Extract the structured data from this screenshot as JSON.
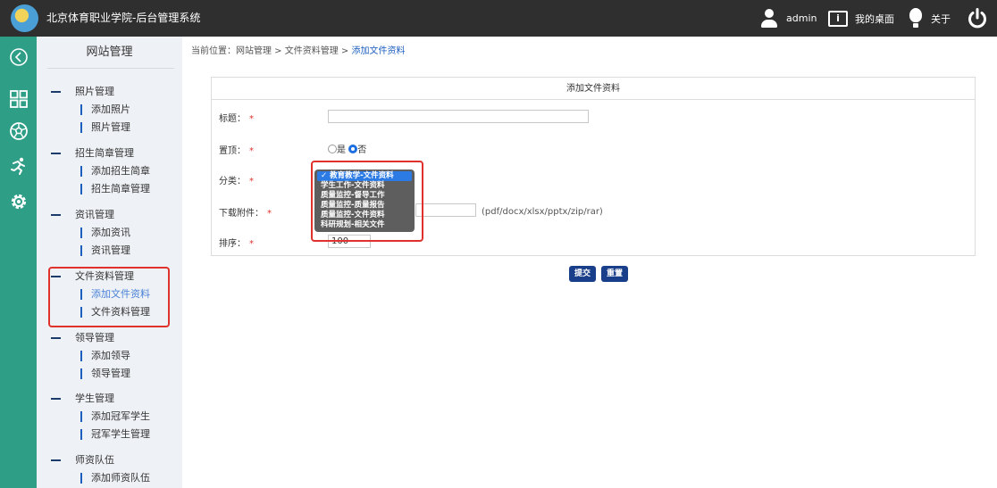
{
  "header": {
    "title": "北京体育职业学院-后台管理系统",
    "user": "admin",
    "desk_icon_glyph": "i",
    "desk": "我的桌面",
    "about": "关于"
  },
  "sidebar": {
    "title": "网站管理",
    "groups": [
      {
        "label": "照片管理",
        "items": [
          "添加照片",
          "照片管理"
        ]
      },
      {
        "label": "招生简章管理",
        "items": [
          "添加招生简章",
          "招生简章管理"
        ]
      },
      {
        "label": "资讯管理",
        "items": [
          "添加资讯",
          "资讯管理"
        ]
      },
      {
        "label": "文件资料管理",
        "items": [
          "添加文件资料",
          "文件资料管理"
        ]
      },
      {
        "label": "领导管理",
        "items": [
          "添加领导",
          "领导管理"
        ]
      },
      {
        "label": "学生管理",
        "items": [
          "添加冠军学生",
          "冠军学生管理"
        ]
      },
      {
        "label": "师资队伍",
        "items": [
          "添加师资队伍"
        ]
      }
    ]
  },
  "breadcrumb": {
    "prefix": "当前位置：网站管理 > 文件资料管理 > ",
    "current": "添加文件资料"
  },
  "form": {
    "title": "添加文件资料",
    "required_mark": "*",
    "title_label": "标题：",
    "title_value": "",
    "pin_label": "置顶：",
    "pin_yes": "是",
    "pin_no": "否",
    "category_label": "分类：",
    "category_options": [
      "✓ 教育教学-文件资料",
      "学生工作-文件资料",
      "质量监控-督导工作",
      "质量监控-质量报告",
      "质量监控-文件资料",
      "科研规划-相关文件"
    ],
    "attachment_label": "下载附件：",
    "attachment_hint": "(pdf/docx/xlsx/pptx/zip/rar)",
    "order_label": "排序：",
    "order_value": "100",
    "submit": "提交",
    "reset": "重置"
  },
  "colors": {
    "header_bg": "#2f2f2f",
    "rail_bg": "#2e9e86",
    "sidebar_bg": "#eef1f5",
    "accent": "#1d5fbf",
    "highlight": "#e0322d",
    "button_bg": "#1a3f8a"
  },
  "icons": {
    "rail": [
      "collapse-arrow-icon",
      "grid-icon",
      "soccer-ball-icon",
      "runner-icon",
      "gear-icon"
    ],
    "header": [
      "user-icon",
      "desk-icon",
      "bulb-icon",
      "power-icon"
    ]
  }
}
